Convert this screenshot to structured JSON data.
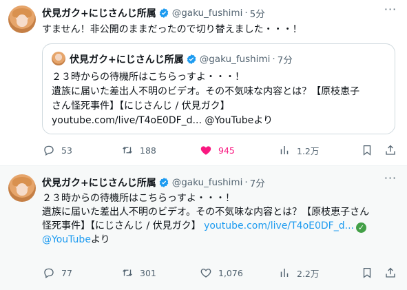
{
  "tweets": [
    {
      "display_name": "伏見ガク+にじさんじ所属",
      "handle": "@gaku_fushimi",
      "separator": "·",
      "time": "5分",
      "more": "···",
      "text": "すません！非公開のままだったので切り替えました・・・！",
      "quote": {
        "display_name": "伏見ガク+にじさんじ所属",
        "handle": "@gaku_fushimi",
        "separator": "·",
        "time": "7分",
        "lines": [
          "２３時からの待機所はこちらっすよ・・・！",
          "遺族に届いた差出人不明のビデオ。その不気味な内容とは？【原枝恵子",
          "さん怪死事件】【にじさんじ / 伏見ガク】",
          "youtube.com/live/T4oE0DF_d... @YouTubeより"
        ]
      },
      "actions": {
        "replies": "53",
        "retweets": "188",
        "likes": "945",
        "views": "1.2万"
      }
    },
    {
      "display_name": "伏見ガク+にじさんじ所属",
      "handle": "@gaku_fushimi",
      "separator": "·",
      "time": "7分",
      "more": "···",
      "lines": {
        "l1": "２３時からの待機所はこちらっすよ・・・！",
        "l2": "遺族に届いた差出人不明のビデオ。その不気味な内容とは？【原枝恵子さん",
        "l3_text": "怪死事件】【にじさんじ / 伏見ガク】 ",
        "l3_link": "youtube.com/live/T4oE0DF_d...",
        "l3_emoji": "✓",
        "l4_link": "@YouTube",
        "l4_text": "より"
      },
      "actions": {
        "replies": "77",
        "retweets": "301",
        "likes": "1,076",
        "views": "2.2万"
      }
    }
  ],
  "colors": {
    "accent": "#1d9bf0",
    "like": "#f91880",
    "muted": "#536471"
  },
  "icons": [
    "verified-badge-icon",
    "more-icon",
    "reply-icon",
    "retweet-icon",
    "like-icon",
    "views-icon",
    "bookmark-icon",
    "share-icon"
  ]
}
